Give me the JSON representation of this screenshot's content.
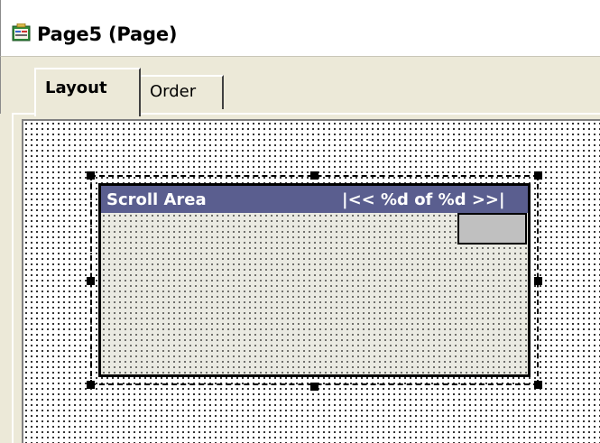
{
  "window": {
    "title": "Page5 (Page)",
    "icon": "page-form-icon"
  },
  "tabs": [
    {
      "label": "Layout",
      "selected": true
    },
    {
      "label": "Order",
      "selected": false
    }
  ],
  "scroll_area": {
    "title": "Scroll Area",
    "pager": "|<< %d of %d >>|",
    "header_color": "#5a5e8f"
  }
}
